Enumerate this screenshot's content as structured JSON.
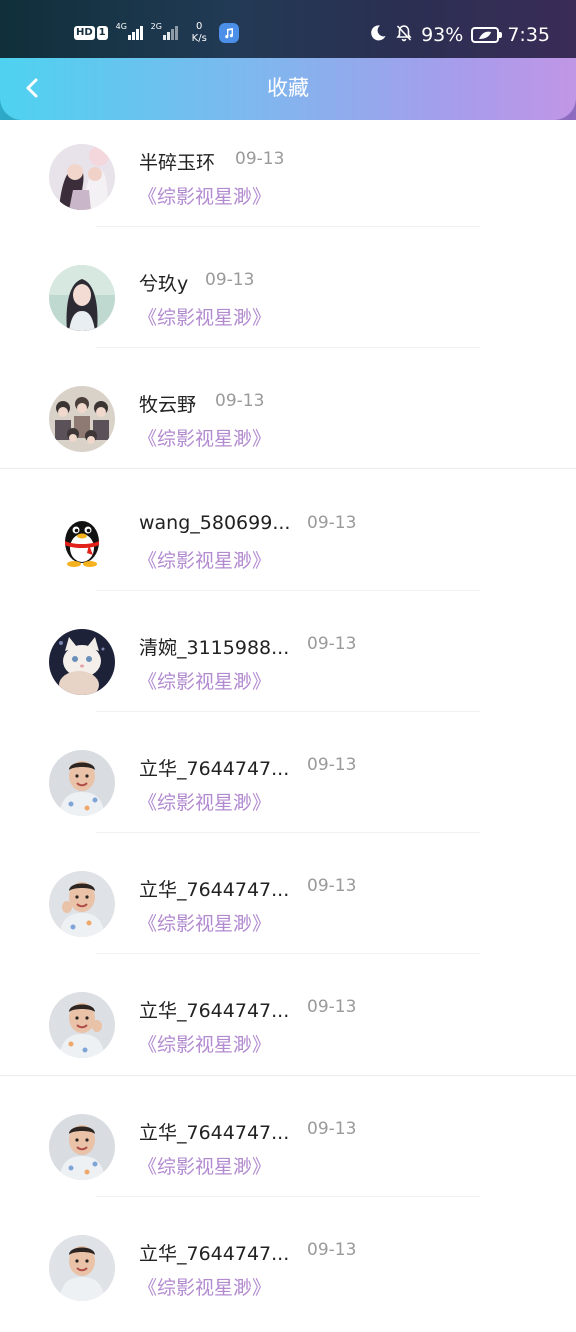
{
  "status_bar": {
    "hd_label": "HD",
    "sim_label": "1",
    "signal_1": "4G",
    "signal_2": "2G",
    "net_speed_value": "0",
    "net_speed_unit": "K/s",
    "battery_percent": "93%",
    "time": "7:35"
  },
  "header": {
    "title": "收藏",
    "back_icon": "chevron-left-icon"
  },
  "favorites": [
    {
      "name": "半碎玉环",
      "date": "09-13",
      "book": "《综影视星渺》",
      "avatar": "anime-couple"
    },
    {
      "name": "兮玖y",
      "date": "09-13",
      "book": "《综影视星渺》",
      "avatar": "girl-portrait"
    },
    {
      "name": "牧云野",
      "date": "09-13",
      "book": "《综影视星渺》",
      "avatar": "anime-group"
    },
    {
      "name": "wang_580699...",
      "date": "09-13",
      "book": "《综影视星渺》",
      "avatar": "qq-penguin"
    },
    {
      "name": "清婉_3115988...",
      "date": "09-13",
      "book": "《综影视星渺》",
      "avatar": "white-cat"
    },
    {
      "name": "立华_7644747...",
      "date": "09-13",
      "book": "《综影视星渺》",
      "avatar": "child-photo"
    },
    {
      "name": "立华_7644747...",
      "date": "09-13",
      "book": "《综影视星渺》",
      "avatar": "child-photo"
    },
    {
      "name": "立华_7644747...",
      "date": "09-13",
      "book": "《综影视星渺》",
      "avatar": "child-photo"
    },
    {
      "name": "立华_7644747...",
      "date": "09-13",
      "book": "《综影视星渺》",
      "avatar": "child-photo"
    },
    {
      "name": "立华_7644747...",
      "date": "09-13",
      "book": "《综影视星渺》",
      "avatar": "child-photo"
    }
  ],
  "colors": {
    "book_title": "#b28ad0",
    "date": "#9a9a9a",
    "name": "#222222"
  }
}
